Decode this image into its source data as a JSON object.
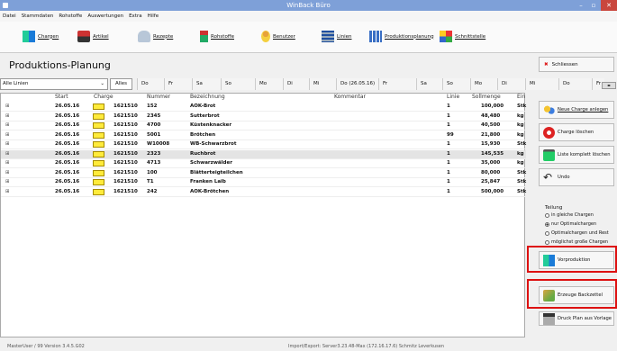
{
  "window": {
    "title": "WinBack Büro"
  },
  "menu": [
    "Datei",
    "Stammdaten",
    "Rohstoffe",
    "Auswertungen",
    "Extra",
    "Hilfe"
  ],
  "toolbar": [
    {
      "label": "Chargen",
      "icon": "grid-icon"
    },
    {
      "label": "Artikel",
      "icon": "items-icon"
    },
    {
      "label": "Rezepte",
      "icon": "recipe-icon"
    },
    {
      "label": "Rohstoffe",
      "icon": "raw-material-icon"
    },
    {
      "label": "Benutzer",
      "icon": "user-icon"
    },
    {
      "label": "Linien",
      "icon": "lines-icon"
    },
    {
      "label": "Produktionsplanung",
      "icon": "planning-icon"
    },
    {
      "label": "Schnittstelle",
      "icon": "interface-icon"
    }
  ],
  "page": {
    "title": "Produktions-Planung"
  },
  "filter": {
    "line": "Alle Linien",
    "all_button": "Alles"
  },
  "days": [
    "Do",
    "Fr",
    "Sa",
    "So",
    "Mo",
    "Di",
    "Mi",
    "Do (26.05.16)",
    "Fr",
    "Sa",
    "So",
    "Mo",
    "Di",
    "Mi",
    "Do",
    "Fr"
  ],
  "table": {
    "columns": [
      "Start",
      "Charge",
      "Nummer",
      "Bezeichnung",
      "Kommentar",
      "Linie",
      "Sollmenge",
      "Ein"
    ],
    "rows": [
      {
        "start": "26.05.16",
        "charge": "1621510",
        "nummer": "152",
        "bez": "AOK-Brot",
        "linie": "1",
        "menge": "100,000",
        "einheit": "Stk"
      },
      {
        "start": "26.05.16",
        "charge": "1621510",
        "nummer": "2345",
        "bez": "Sutterbrot",
        "linie": "1",
        "menge": "48,480",
        "einheit": "kg"
      },
      {
        "start": "26.05.16",
        "charge": "1621510",
        "nummer": "4700",
        "bez": "Küstenknacker",
        "linie": "1",
        "menge": "40,500",
        "einheit": "kg"
      },
      {
        "start": "26.05.16",
        "charge": "1621510",
        "nummer": "5001",
        "bez": "Brötchen",
        "linie": "99",
        "menge": "21,800",
        "einheit": "kg"
      },
      {
        "start": "26.05.16",
        "charge": "1621510",
        "nummer": "W10008",
        "bez": "WB-Schwarzbrot",
        "linie": "1",
        "menge": "15,930",
        "einheit": "Stk"
      },
      {
        "start": "26.05.16",
        "charge": "1621510",
        "nummer": "2323",
        "bez": "Ruchbrot",
        "linie": "1",
        "menge": "145,535",
        "einheit": "kg"
      },
      {
        "start": "26.05.16",
        "charge": "1621510",
        "nummer": "4713",
        "bez": "Schwarzwälder",
        "linie": "1",
        "menge": "35,000",
        "einheit": "kg"
      },
      {
        "start": "26.05.16",
        "charge": "1621510",
        "nummer": "100",
        "bez": "Blätterteigteilchen",
        "linie": "1",
        "menge": "80,000",
        "einheit": "Stk"
      },
      {
        "start": "26.05.16",
        "charge": "1621510",
        "nummer": "T1",
        "bez": "Franken Laib",
        "linie": "1",
        "menge": "25,847",
        "einheit": "Stk"
      },
      {
        "start": "26.05.16",
        "charge": "1621510",
        "nummer": "242",
        "bez": "AOK-Brötchen",
        "linie": "1",
        "menge": "500,000",
        "einheit": "Stk"
      }
    ]
  },
  "side": {
    "close": "Schliessen",
    "new_charge": "Neue Charge anlegen",
    "delete_charge": "Charge löschen",
    "delete_list": "Liste komplett löschen",
    "undo": "Undo",
    "split_label": "Teilung",
    "split_options": [
      "in gleiche Chargen",
      "nur Optimalchargen",
      "Optimalchargen und Rest",
      "möglichst große Chargen"
    ],
    "vorproduktion": "Vorproduktion",
    "backzettel": "Erzeuge Backzettel",
    "druck": "Druck Plan aus Vorlage"
  },
  "status": {
    "left": "MasterUser / 99   Version 3.4.5.G02",
    "center": "Import/Export: Server3.23.48-Max (172.16.17.6) Schmitz Leverkusen"
  },
  "colors": {
    "titlebar": "#7ea0d8",
    "highlight": "#d11111",
    "selected_row": "#e4e4e4"
  }
}
